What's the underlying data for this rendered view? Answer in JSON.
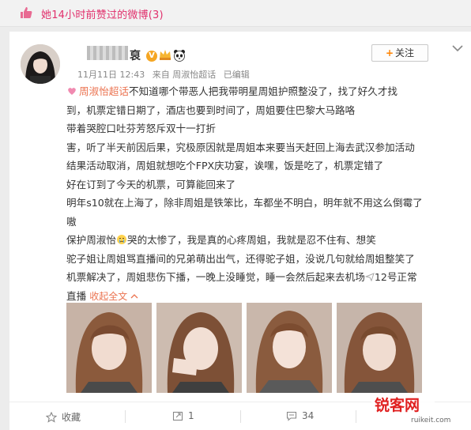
{
  "banner": {
    "text": "她14小时前赞过的微博(3)"
  },
  "author": {
    "name_visible": "裒",
    "verified_badge": "V",
    "follow_label": "关注"
  },
  "meta": {
    "time": "11月11日 12:43",
    "source": "来自 周淑怡超话",
    "edited": "已编辑"
  },
  "post": {
    "tag": "周淑怡超话",
    "lines": [
      "不知道哪个带恶人把我带明星周姐护照整没了，找了好久才找",
      "到，机票定错日期了，酒店也要到时间了，周姐要住巴黎大马路咯",
      "带着哭腔口吐芬芳怒斥双十一打折",
      "害，听了半天前因后果，究极原因就是周姐本来要当天赶回上海去武汉参加活动",
      "结果活动取消，周姐就想吃个FPX庆功宴，诶嘿，饭是吃了，机票定错了",
      "好在订到了今天的机票，可算能回来了",
      "明年s10就在上海了，除非周姐是铁笨比，车都坐不明白，明年就不用这么倒霉了",
      "嗷",
      "保护周淑怡",
      "哭的太惨了，我是真的心疼周姐，我就是忍不住有、想笑",
      "驼子姐让周姐骂直播间的兄弟萌出出气，还得驼子姐，没说几句就给周姐整笑了",
      "机票解决了，周姐悲伤下播，一晚上没睡觉，睡一会然后起来去机场",
      "12号正常",
      "直播",
      "收起全文"
    ]
  },
  "thumbnails": [
    {
      "name": "photo-1"
    },
    {
      "name": "photo-2"
    },
    {
      "name": "photo-3"
    },
    {
      "name": "photo-4"
    }
  ],
  "toolbar": {
    "favorite_label": "收藏",
    "repost_count": "1",
    "comment_count": "34",
    "like_label": "赞"
  },
  "watermark": {
    "logo": "锐客网",
    "url": "ruikeit.com"
  },
  "colors": {
    "accent": "#eb7350",
    "banner_text": "#e1306c",
    "follow_plus": "#ff8200",
    "verified": "#f5a623",
    "logo_red": "#e02020"
  },
  "icons": [
    "thumbs-up-icon",
    "verified-icon",
    "crown-icon",
    "panda-icon",
    "chevron-down-icon",
    "star-icon",
    "repost-icon",
    "comment-icon",
    "thumbs-up-icon"
  ]
}
